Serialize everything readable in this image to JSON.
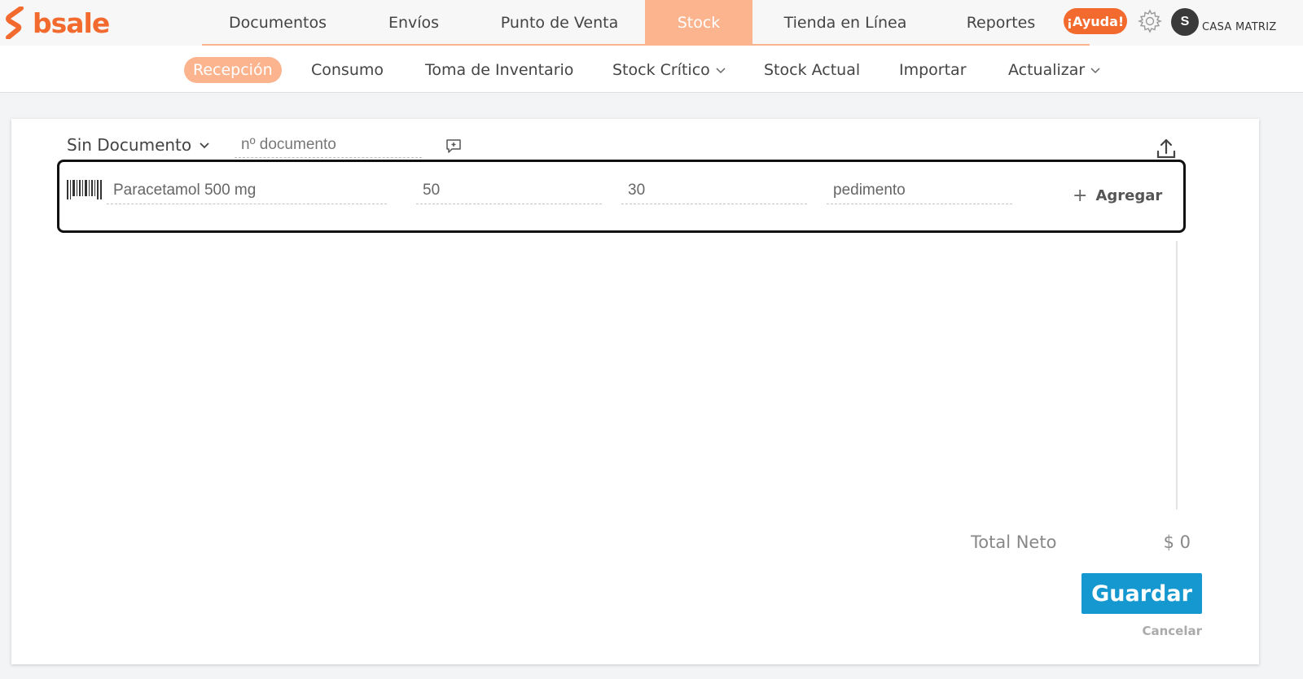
{
  "brand": {
    "name": "bsale",
    "color": "#f26a2e"
  },
  "main_nav": [
    {
      "label": "Documentos",
      "active": false
    },
    {
      "label": "Envíos",
      "active": false
    },
    {
      "label": "Punto de Venta",
      "active": false
    },
    {
      "label": "Stock",
      "active": true
    },
    {
      "label": "Tienda en Línea",
      "active": false
    },
    {
      "label": "Reportes",
      "active": false
    }
  ],
  "header": {
    "help_label": "¡Ayuda!",
    "settings_icon": "gear-icon",
    "avatar_initial": "S",
    "branch": "CASA MATRIZ"
  },
  "sub_nav": [
    {
      "label": "Recepción",
      "active": true,
      "dropdown": false
    },
    {
      "label": "Consumo",
      "active": false,
      "dropdown": false
    },
    {
      "label": "Toma de Inventario",
      "active": false,
      "dropdown": false
    },
    {
      "label": "Stock Crítico",
      "active": false,
      "dropdown": true
    },
    {
      "label": "Stock Actual",
      "active": false,
      "dropdown": false
    },
    {
      "label": "Importar",
      "active": false,
      "dropdown": false
    },
    {
      "label": "Actualizar",
      "active": false,
      "dropdown": true
    }
  ],
  "form": {
    "doc_type": "Sin Documento",
    "doc_number_placeholder": "nº documento",
    "product_value": "Paracetamol 500 mg",
    "quantity_value": "50",
    "cost_value": "30",
    "note_value": "pedimento",
    "add_label": "Agregar"
  },
  "totals": {
    "label": "Total Neto",
    "value": "$ 0"
  },
  "actions": {
    "save_label": "Guardar",
    "cancel_label": "Cancelar"
  },
  "colors": {
    "accent": "#fbb48e",
    "orange": "#f26a2e",
    "primary": "#1598d0"
  }
}
